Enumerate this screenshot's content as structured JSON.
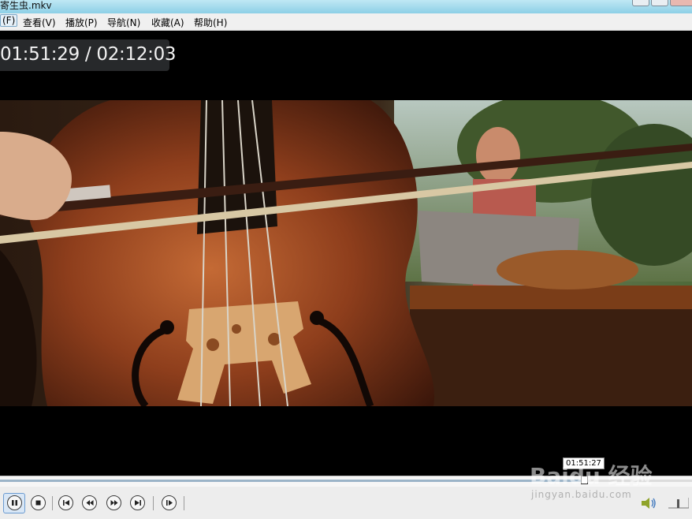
{
  "window": {
    "title": "寄生虫.mkv"
  },
  "menu": [
    {
      "label": "(F)"
    },
    {
      "label": "查看(V)"
    },
    {
      "label": "播放(P)"
    },
    {
      "label": "导航(N)"
    },
    {
      "label": "收藏(A)"
    },
    {
      "label": "帮助(H)"
    }
  ],
  "osd": {
    "time": "01:51:29 / 02:12:03"
  },
  "seek": {
    "tooltip": "01:51:27",
    "progress": 0.8436
  },
  "controls": {
    "buttons": [
      "pause",
      "stop",
      "previous",
      "rewind",
      "fast-forward",
      "next",
      "frame-step"
    ]
  },
  "watermark": {
    "main": "Baidu 经验",
    "sub": "jingyan.baidu.com"
  },
  "colors": {
    "title_bar": "#8ccfe6",
    "menu_bar": "#f0f0f0",
    "video_bg": "#000000",
    "controls_bg": "#ededed"
  }
}
